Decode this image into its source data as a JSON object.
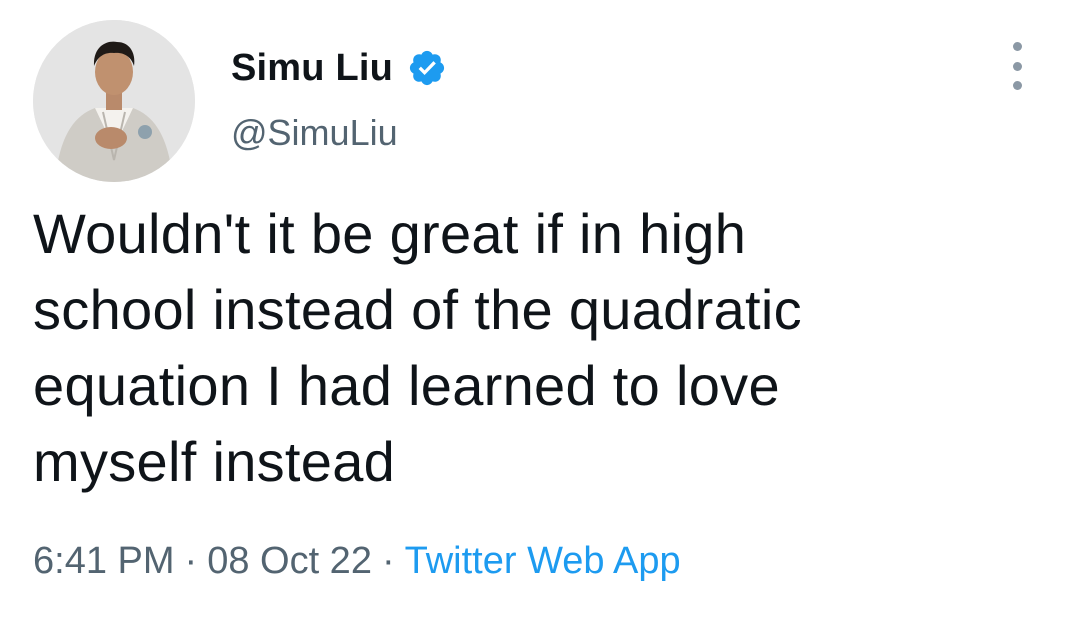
{
  "author": {
    "display_name": "Simu Liu",
    "handle": "@SimuLiu",
    "verified": true,
    "verified_color": "#1d9bf0"
  },
  "tweet": {
    "lines": [
      "Wouldn't it be great if in high",
      "school instead of the quadratic",
      "equation I had learned to love",
      "myself instead"
    ]
  },
  "meta": {
    "time": "6:41 PM",
    "date": "08 Oct 22",
    "source": "Twitter Web App",
    "separator": "·"
  },
  "icons": {
    "verified": "verified-badge-icon",
    "more": "more-options-icon"
  },
  "colors": {
    "text": "#0f1419",
    "secondary": "#536471",
    "accent": "#1d9bf0"
  }
}
